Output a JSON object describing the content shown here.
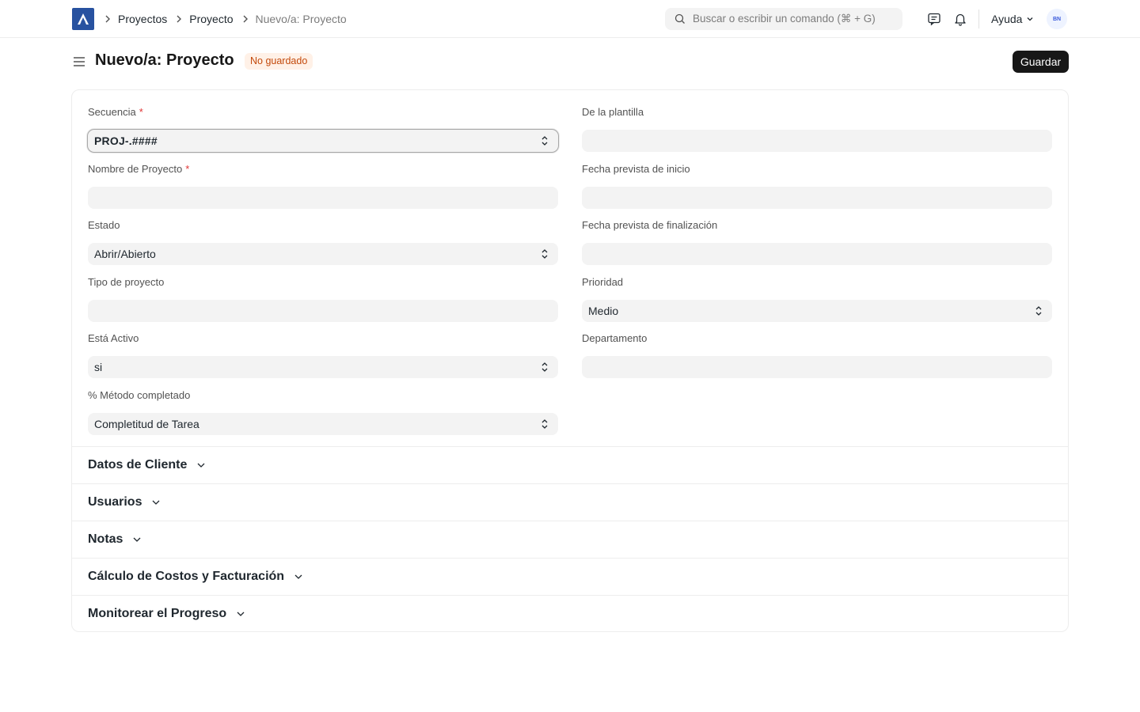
{
  "navbar": {
    "breadcrumbs": [
      "Proyectos",
      "Proyecto",
      "Nuevo/a: Proyecto"
    ],
    "search_placeholder": "Buscar o escribir un comando (⌘ + G)",
    "help_label": "Ayuda",
    "avatar_initials": "BN"
  },
  "page": {
    "title": "Nuevo/a: Proyecto",
    "status_badge": "No guardado",
    "save_label": "Guardar"
  },
  "form": {
    "left": [
      {
        "label": "Secuencia",
        "required": "*",
        "value": "PROJ-.####",
        "type": "select"
      },
      {
        "label": "Nombre de Proyecto",
        "required": "*",
        "value": "",
        "type": "text"
      },
      {
        "label": "Estado",
        "required": "",
        "value": "Abrir/Abierto",
        "type": "select"
      },
      {
        "label": "Tipo de proyecto",
        "required": "",
        "value": "",
        "type": "text"
      },
      {
        "label": "Está Activo",
        "required": "",
        "value": "si",
        "type": "select"
      },
      {
        "label": "% Método completado",
        "required": "",
        "value": "Completitud de Tarea",
        "type": "select"
      }
    ],
    "right": [
      {
        "label": "De la plantilla",
        "value": "",
        "type": "text"
      },
      {
        "label": "Fecha prevista de inicio",
        "value": "",
        "type": "text"
      },
      {
        "label": "Fecha prevista de finalización",
        "value": "",
        "type": "text"
      },
      {
        "label": "Prioridad",
        "value": "Medio",
        "type": "select"
      },
      {
        "label": "Departamento",
        "value": "",
        "type": "text"
      }
    ]
  },
  "sections": [
    "Datos de Cliente",
    "Usuarios",
    "Notas",
    "Cálculo de Costos y Facturación",
    "Monitorear el Progreso"
  ]
}
